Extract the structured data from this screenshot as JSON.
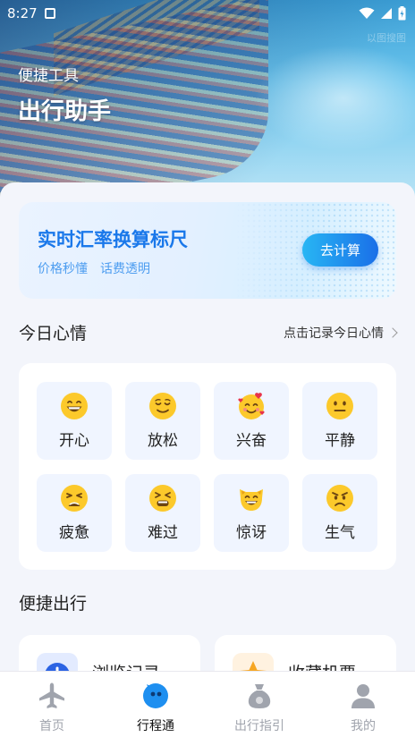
{
  "status_bar": {
    "time": "8:27"
  },
  "hero": {
    "watermark": "以图搜图",
    "subtitle": "便捷工具",
    "title": "出行助手"
  },
  "rate_card": {
    "title": "实时汇率换算标尺",
    "tags": [
      "价格秒懂",
      "话费透明"
    ],
    "button_label": "去计算"
  },
  "mood_section": {
    "title": "今日心情",
    "link_label": "点击记录今日心情",
    "moods": [
      {
        "label": "开心",
        "icon": "grinning-face-icon"
      },
      {
        "label": "放松",
        "icon": "relieved-face-icon"
      },
      {
        "label": "兴奋",
        "icon": "smiling-face-with-hearts-icon"
      },
      {
        "label": "平静",
        "icon": "neutral-face-icon"
      },
      {
        "label": "疲惫",
        "icon": "weary-face-icon"
      },
      {
        "label": "难过",
        "icon": "tired-face-icon"
      },
      {
        "label": "惊讶",
        "icon": "cat-face-icon"
      },
      {
        "label": "生气",
        "icon": "angry-face-icon"
      }
    ]
  },
  "quick_section": {
    "title": "便捷出行",
    "cards": [
      {
        "label": "浏览记录",
        "icon": "clock-icon",
        "color": "#2b63e3"
      },
      {
        "label": "收藏机票",
        "icon": "star-icon",
        "color": "#f6a623"
      }
    ]
  },
  "bottom_nav": {
    "items": [
      {
        "label": "首页",
        "icon": "airplane-icon",
        "active": false
      },
      {
        "label": "行程通",
        "icon": "chat-bubble-icon",
        "active": true
      },
      {
        "label": "出行指引",
        "icon": "money-bag-icon",
        "active": false
      },
      {
        "label": "我的",
        "icon": "user-icon",
        "active": false
      }
    ]
  },
  "colors": {
    "accent": "#1a78ea",
    "active_nav": "#1e8ff0",
    "inactive_nav": "#a0a4ad"
  }
}
